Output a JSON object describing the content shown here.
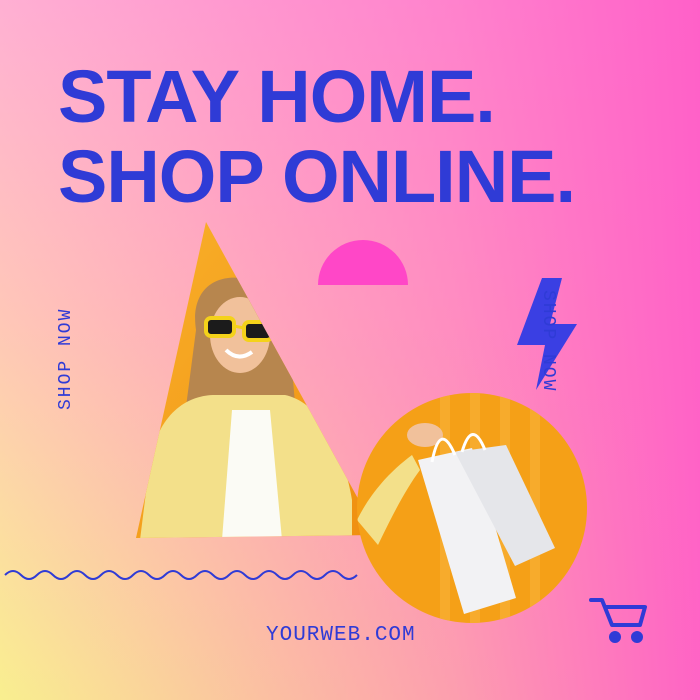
{
  "headline": {
    "line1": "STAY HOME.",
    "line2": "SHOP ONLINE."
  },
  "side_text_left": "SHOP NOW",
  "side_text_right": "SHOP NOW",
  "website": "YOURWEB.COM",
  "colors": {
    "accent_blue": "#2f3bd6",
    "accent_pink": "#ff47c7",
    "photo_orange": "#f7a11a",
    "gradient_top": "#ffb0d3",
    "gradient_bottom": "#f9ef8f"
  },
  "icons": [
    "half-circle-shape",
    "lightning-bolt-icon",
    "shopping-cart-icon",
    "wavy-line"
  ],
  "photo": {
    "subject": "smiling woman with yellow sunglasses",
    "prop": "white shopping bags"
  }
}
